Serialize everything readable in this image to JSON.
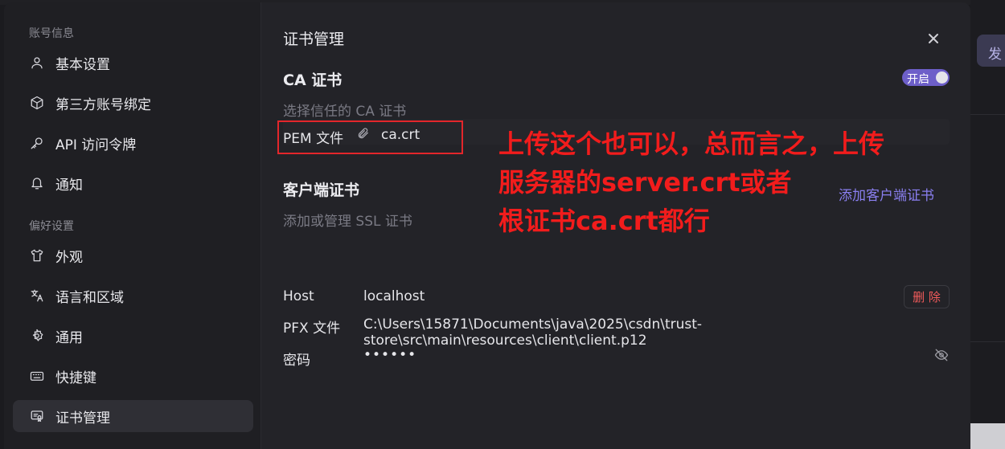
{
  "background": {
    "send_button_label": "发"
  },
  "sidebar": {
    "section_account": "账号信息",
    "section_prefs": "偏好设置",
    "items": [
      {
        "label": "基本设置",
        "icon": "user-icon"
      },
      {
        "label": "第三方账号绑定",
        "icon": "cube-icon"
      },
      {
        "label": "API 访问令牌",
        "icon": "key-icon"
      },
      {
        "label": "通知",
        "icon": "bell-icon"
      },
      {
        "label": "外观",
        "icon": "shirt-icon"
      },
      {
        "label": "语言和区域",
        "icon": "translate-icon"
      },
      {
        "label": "通用",
        "icon": "gear-icon"
      },
      {
        "label": "快捷键",
        "icon": "keyboard-icon"
      },
      {
        "label": "证书管理",
        "icon": "certificate-icon",
        "active": true
      }
    ]
  },
  "main": {
    "title": "证书管理",
    "ca": {
      "heading": "CA 证书",
      "toggle_label": "开启",
      "description": "选择信任的 CA 证书",
      "pem_label": "PEM 文件",
      "pem_file": "ca.crt"
    },
    "client": {
      "heading": "客户端证书",
      "description": "添加或管理 SSL 证书",
      "add_label": "添加客户端证书",
      "host_label": "Host",
      "host_value": "localhost",
      "delete_label": "删 除",
      "pfx_label": "PFX 文件",
      "pfx_value": "C:\\Users\\15871\\Documents\\java\\2025\\csdn\\trust-store\\src\\main\\resources\\client\\client.p12",
      "password_label": "密码",
      "password_value": "••••••"
    },
    "annotation": {
      "lines": [
        "上传这个也可以，总而言之，上传",
        "服务器的server.crt或者",
        "根证书ca.crt都行"
      ]
    }
  },
  "colors": {
    "accent": "#6d5fc9",
    "link": "#8a7ff0",
    "danger": "#f25b5b",
    "annotation": "#f21c1c"
  }
}
